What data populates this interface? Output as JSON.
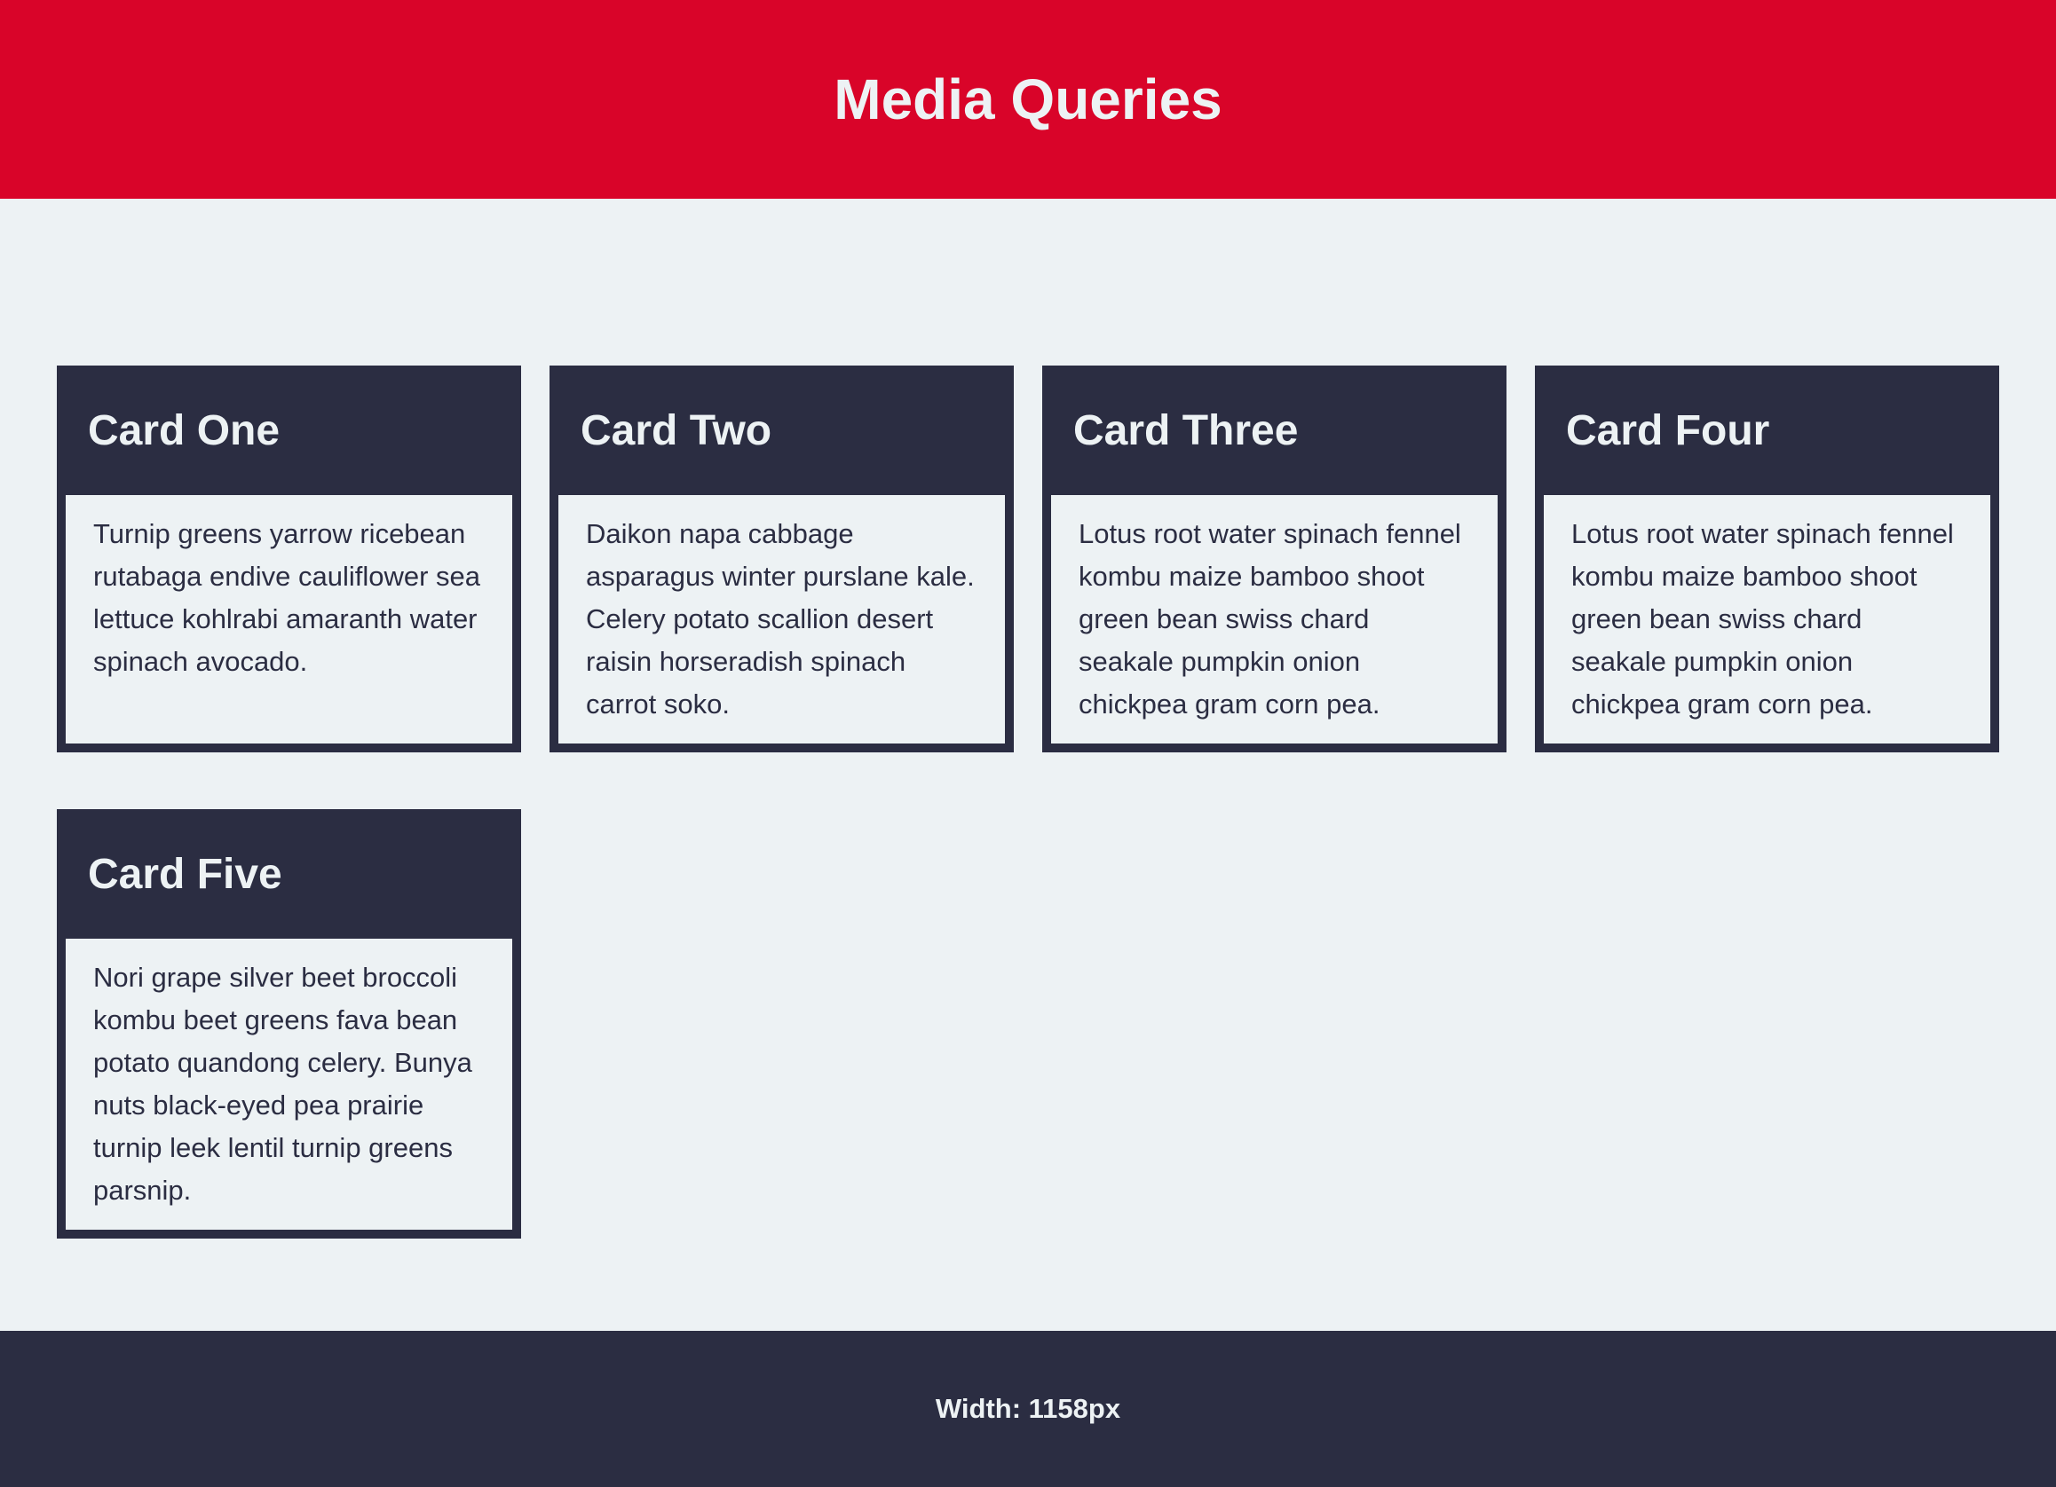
{
  "header": {
    "title": "Media Queries"
  },
  "cards": [
    {
      "title": "Card One",
      "body": "Turnip greens yarrow ricebean rutabaga endive cauliflower sea lettuce kohlrabi amaranth water spinach avocado."
    },
    {
      "title": "Card Two",
      "body": "Daikon napa cabbage asparagus winter purslane kale. Celery potato scallion desert raisin horseradish spinach carrot soko."
    },
    {
      "title": "Card Three",
      "body": "Lotus root water spinach fennel kombu maize bamboo shoot green bean swiss chard seakale pumpkin onion chickpea gram corn pea."
    },
    {
      "title": "Card Four",
      "body": "Lotus root water spinach fennel kombu maize bamboo shoot green bean swiss chard seakale pumpkin onion chickpea gram corn pea."
    },
    {
      "title": "Card Five",
      "body": "Nori grape silver beet broccoli kombu beet greens fava bean potato quandong celery. Bunya nuts black-eyed pea prairie turnip leek lentil turnip greens parsnip."
    }
  ],
  "footer": {
    "width_label": "Width: 1158px"
  },
  "colors": {
    "header_bg": "#d90429",
    "dark": "#2b2d42",
    "light": "#edf2f4"
  }
}
